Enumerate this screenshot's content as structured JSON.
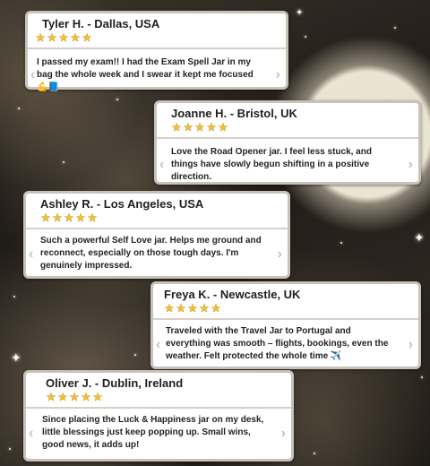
{
  "reviews": [
    {
      "name": "Tyler H. -  Dallas, USA",
      "stars": [
        "★",
        "★",
        "★",
        "★",
        "★"
      ],
      "text": "I passed my exam!! I had the Exam Spell Jar in my bag the whole week and I swear it kept me focused 💪📘"
    },
    {
      "name": "Joanne H. - Bristol, UK",
      "stars": [
        "★",
        "★",
        "★",
        "★",
        "★"
      ],
      "text": "Love the Road Opener jar. I feel less stuck, and things have slowly begun shifting in a positive direction."
    },
    {
      "name": "Ashley R. -  Los Angeles, USA",
      "stars": [
        "★",
        "★",
        "★",
        "★",
        "★"
      ],
      "text": "Such a powerful Self Love jar. Helps me ground and reconnect, especially on those tough days. I'm genuinely impressed."
    },
    {
      "name": "Freya K. -  Newcastle, UK",
      "stars": [
        "★",
        "★",
        "★",
        "★",
        "★"
      ],
      "text": "Traveled with the Travel Jar to Portugal and everything was smooth – flights, bookings, even the weather. Felt protected the whole time ✈️"
    },
    {
      "name": "Oliver J. -  Dublin, Ireland",
      "stars": [
        "★",
        "★",
        "★",
        "★",
        "★"
      ],
      "text": "Since placing the Luck & Happiness jar on my desk, little blessings just keep popping up. Small wins, good news, it adds up!"
    }
  ],
  "nav": {
    "prev": "‹",
    "next": "›"
  },
  "colors": {
    "star": "#f7c52b",
    "card_border": "#c9c2b8",
    "text": "#232323"
  }
}
